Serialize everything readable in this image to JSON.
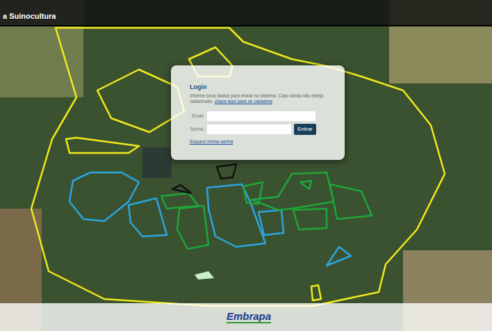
{
  "header": {
    "title": "a Suinocultura"
  },
  "login": {
    "title": "Login",
    "intro": "Informe seus dados para entrar no sistema. Caso ainda não esteja cadastrado,",
    "signup_link": "clique aqui para se cadastrar",
    "signup_end": ".",
    "fields": [
      {
        "label": "Email:",
        "value": ""
      },
      {
        "label": "Senha:",
        "value": ""
      }
    ],
    "submit": "Entrar",
    "forgot": "Esqueci minha senha"
  },
  "map": {
    "areas": [
      {
        "color": "#f2ea1c"
      },
      {
        "color": "#f2ea1c"
      },
      {
        "color": "#f2ea1c"
      },
      {
        "color": "#f2ea1c"
      },
      {
        "color": "#f2ea1c"
      },
      {
        "color": "#2ba6e0"
      },
      {
        "color": "#2ba6e0"
      },
      {
        "color": "#2ba6e0"
      },
      {
        "color": "#2ba6e0"
      },
      {
        "color": "#2ba6e0"
      },
      {
        "color": "#1fa53a"
      },
      {
        "color": "#1fa53a"
      },
      {
        "color": "#1fa53a"
      },
      {
        "color": "#1fa53a"
      },
      {
        "color": "#1fa53a"
      },
      {
        "color": "#1fa53a"
      },
      {
        "color": "#1fa53a"
      },
      {
        "color": "#111111"
      },
      {
        "color": "#111111"
      }
    ]
  },
  "footer": {
    "logo": "Embrapa"
  }
}
